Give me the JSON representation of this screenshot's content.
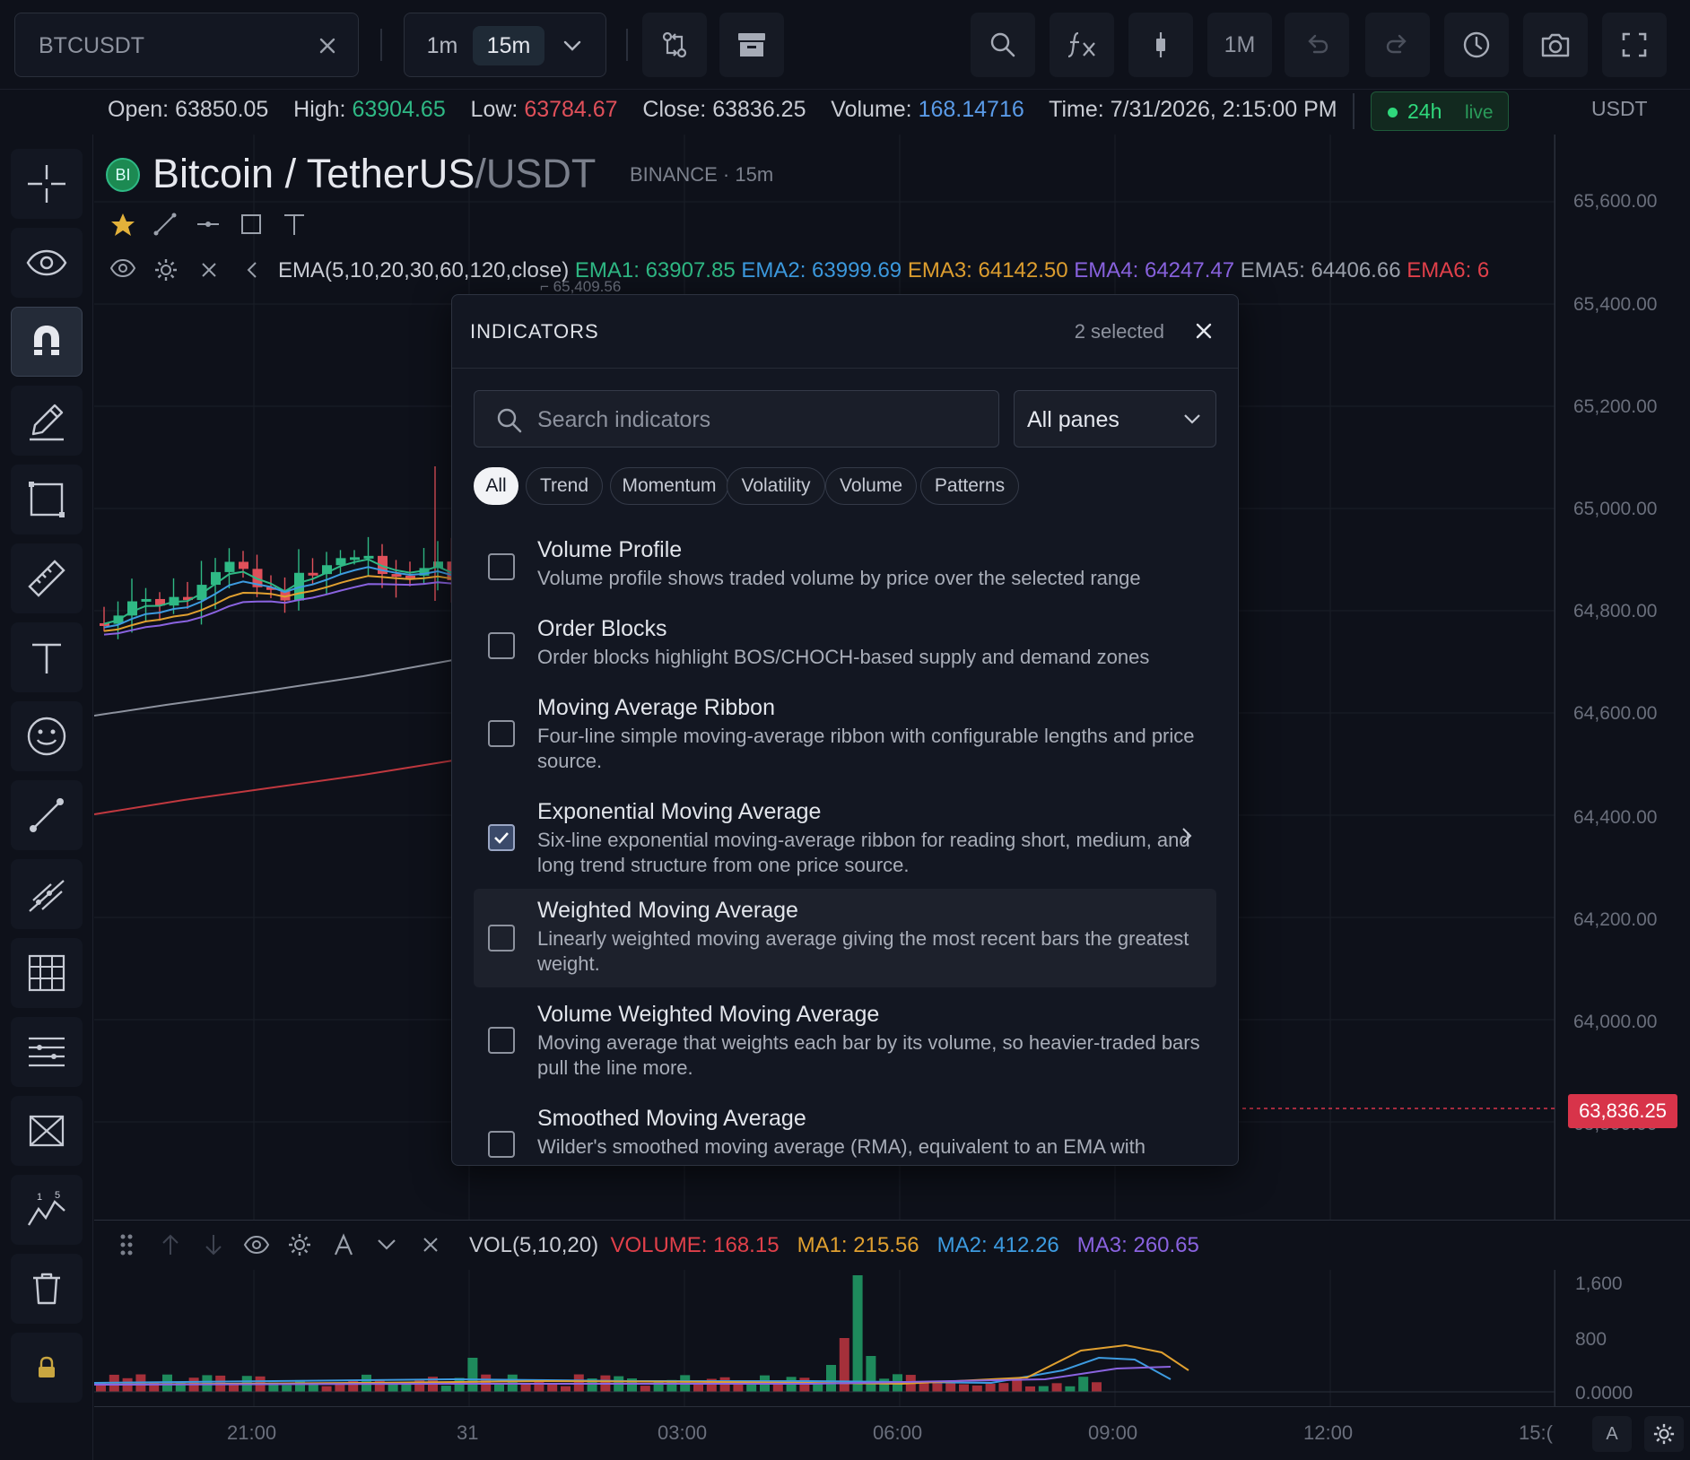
{
  "toolbar": {
    "symbol": "BTCUSDT",
    "timeframes": [
      "1m",
      "15m"
    ],
    "range_label": "1M"
  },
  "ohlc": {
    "open_label": "Open:",
    "open": "63850.05",
    "high_label": "High:",
    "high": "63904.65",
    "low_label": "Low:",
    "low": "63784.67",
    "close_label": "Close:",
    "close": "63836.25",
    "volume_label": "Volume:",
    "volume": "168.14716",
    "time_label": "Time:",
    "time": "7/31/2026, 2:15:00 PM",
    "live_window": "24h",
    "live_status": "live",
    "currency": "USDT"
  },
  "chart": {
    "logo_text": "BI",
    "pair_name": "Bitcoin / TetherUS",
    "quote": "/USDT",
    "exchange": "BINANCE",
    "separator": "·",
    "interval": "15m",
    "high_marker": "65,409.56",
    "price_labels": [
      "65,600.00",
      "65,400.00",
      "65,200.00",
      "65,000.00",
      "64,800.00",
      "64,600.00",
      "64,400.00",
      "64,200.00",
      "64,000.00",
      "63,800.00"
    ],
    "current_price": "63,836.25",
    "colors": {
      "up": "#2fb985",
      "down": "#e0505a",
      "accent": "#d8344a"
    }
  },
  "ema_legend": {
    "label": "EMA(5,10,20,30,60,120,close)",
    "ema1": "EMA1: 63907.85",
    "ema2": "EMA2: 63999.69",
    "ema3": "EMA3: 64142.50",
    "ema4": "EMA4: 64247.47",
    "ema5": "EMA5: 64406.66",
    "ema6": "EMA6: 6",
    "colors": [
      "#2fb985",
      "#3d9be0",
      "#e0a030",
      "#8a63e0",
      "#9aa0ab",
      "#e0404a"
    ]
  },
  "volume_legend": {
    "label": "VOL(5,10,20)",
    "volume": "VOLUME: 168.15",
    "ma1": "MA1: 215.56",
    "ma2": "MA2: 412.26",
    "ma3": "MA3: 260.65",
    "scale": [
      "1,600",
      "800",
      "0.0000"
    ]
  },
  "time_axis": [
    "21:00",
    "31",
    "03:00",
    "06:00",
    "09:00",
    "12:00",
    "15:("
  ],
  "corner": {
    "auto": "A"
  },
  "modal": {
    "title": "INDICATORS",
    "selected": "2 selected",
    "search_placeholder": "Search indicators",
    "pane_filter": "All panes",
    "categories": [
      "All",
      "Trend",
      "Momentum",
      "Volatility",
      "Volume",
      "Patterns"
    ],
    "active_category": "All",
    "indicators": [
      {
        "name": "Volume Profile",
        "desc": "Volume profile shows traded volume by price over the selected range",
        "checked": false
      },
      {
        "name": "Order Blocks",
        "desc": "Order blocks highlight BOS/CHOCH-based supply and demand zones",
        "checked": false
      },
      {
        "name": "Moving Average Ribbon",
        "desc": "Four-line simple moving-average ribbon with configurable lengths and price source.",
        "checked": false
      },
      {
        "name": "Exponential Moving Average",
        "desc": "Six-line exponential moving-average ribbon for reading short, medium, and long trend structure from one price source.",
        "checked": true
      },
      {
        "name": "Weighted Moving Average",
        "desc": "Linearly weighted moving average giving the most recent bars the greatest weight.",
        "checked": false
      },
      {
        "name": "Volume Weighted Moving Average",
        "desc": "Moving average that weights each bar by its volume, so heavier-traded bars pull the line more.",
        "checked": false
      },
      {
        "name": "Smoothed Moving Average",
        "desc": "Wilder's smoothed moving average (RMA), equivalent to an EMA with",
        "checked": false
      }
    ]
  }
}
